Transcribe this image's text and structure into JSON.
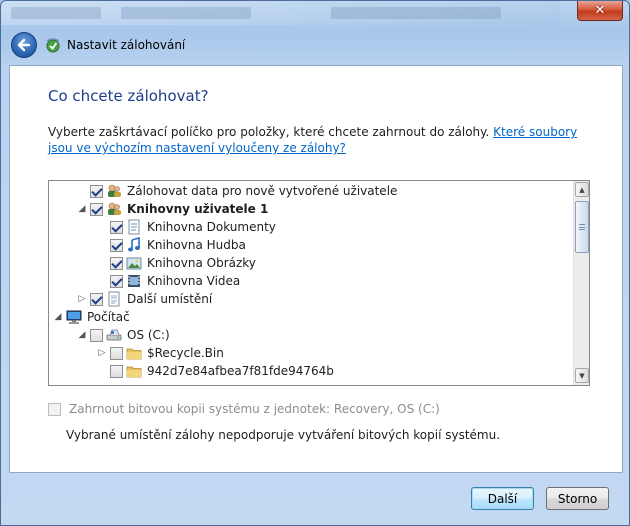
{
  "window": {
    "title": "Nastavit zálohování",
    "close_glyph": "✕",
    "background_strip_text": [
      "",
      "",
      ""
    ]
  },
  "page": {
    "heading": "Co chcete zálohovat?",
    "intro_text": "Vyberte zaškrtávací políčko pro položky, které chcete zahrnout do zálohy. ",
    "intro_link": "Které soubory jsou ve výchozím nastavení vyloučeny ze zálohy?"
  },
  "tree": {
    "items": [
      {
        "label": "Zálohovat data pro nově vytvořené uživatele",
        "expander": "",
        "checked": true,
        "icon": "users-icon",
        "bold": false
      },
      {
        "label": "Knihovny uživatele 1",
        "expander": "◢",
        "checked": true,
        "icon": "users-icon",
        "bold": true
      },
      {
        "label": "Knihovna Dokumenty",
        "expander": "",
        "checked": true,
        "icon": "documents-library-icon",
        "bold": false
      },
      {
        "label": "Knihovna Hudba",
        "expander": "",
        "checked": true,
        "icon": "music-library-icon",
        "bold": false
      },
      {
        "label": "Knihovna Obrázky",
        "expander": "",
        "checked": true,
        "icon": "pictures-library-icon",
        "bold": false
      },
      {
        "label": "Knihovna Videa",
        "expander": "",
        "checked": true,
        "icon": "videos-library-icon",
        "bold": false
      },
      {
        "label": "Další umístění",
        "expander": "▷",
        "checked": true,
        "icon": "other-locations-icon",
        "bold": false
      },
      {
        "label": "Počítač",
        "expander": "◢",
        "checked": null,
        "icon": "computer-icon",
        "bold": false
      },
      {
        "label": "OS (C:)",
        "expander": "◢",
        "checked": false,
        "icon": "drive-icon",
        "bold": false
      },
      {
        "label": "$Recycle.Bin",
        "expander": "▷",
        "checked": false,
        "icon": "folder-icon",
        "bold": false
      },
      {
        "label": "942d7e84afbea7f81fde94764b",
        "expander": "",
        "checked": false,
        "icon": "folder-icon",
        "bold": false
      }
    ]
  },
  "system_image": {
    "label": "Zahrnout bitovou kopii systému z jednotek: Recovery, OS (C:)",
    "checked": false,
    "enabled": false
  },
  "note": "Vybrané umístění zálohy nepodporuje vytváření bitových kopií systému.",
  "buttons": {
    "next": "Další",
    "cancel": "Storno"
  },
  "colors": {
    "heading": "#1c3e8a",
    "link": "#0066cc",
    "frame": "#a7c6ea",
    "close": "#c23a1c"
  }
}
